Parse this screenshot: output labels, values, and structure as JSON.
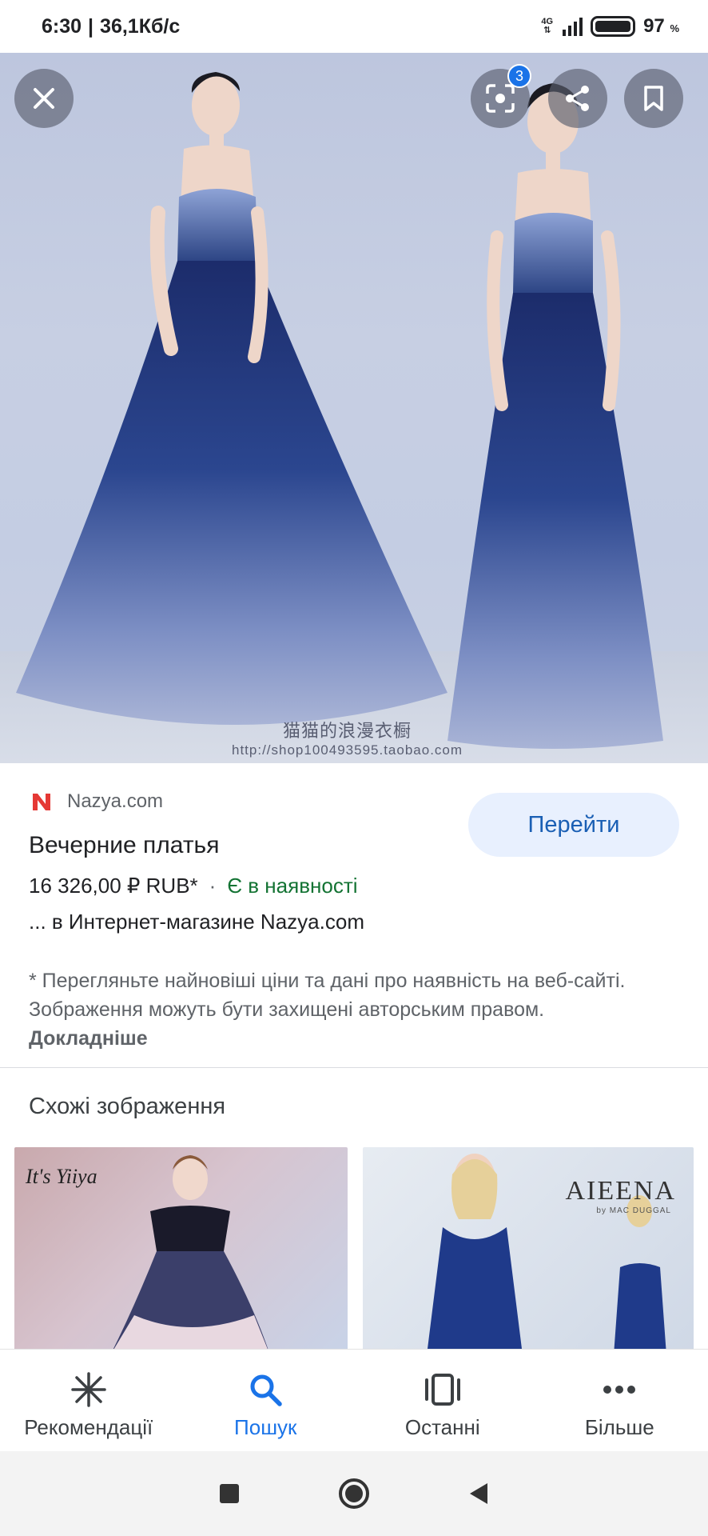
{
  "status_bar": {
    "time": "6:30",
    "separator": "|",
    "speed": "36,1Кб/с",
    "network": "4G",
    "battery_percent": "97",
    "battery_unit": "%"
  },
  "hero": {
    "watermark_cn": "猫猫的浪漫衣橱",
    "watermark_url": "http://shop100493595.taobao.com",
    "lens_badge_count": "3"
  },
  "result": {
    "source_name": "Nazya.com",
    "go_button_label": "Перейти",
    "title": "Вечерние платья",
    "price": "16 326,00 ₽ RUB*",
    "price_separator": "·",
    "availability": "Є в наявності",
    "snippet": "... в Интернет-магазине Nazya.com",
    "disclaimer_text": "* Перегляньте найновіші ціни та дані про наявність на веб-сайті. Зображення можуть бути захищені авторським правом.",
    "disclaimer_link": "Докладніше"
  },
  "similar": {
    "title": "Схожі зображення",
    "items": [
      {
        "caption": "It's Yiiya"
      },
      {
        "caption": "AIEENA",
        "subcaption": "by MAC DUGGAL"
      }
    ]
  },
  "bottom_nav": {
    "items": [
      {
        "label": "Рекомендації",
        "icon": "asterisk-icon"
      },
      {
        "label": "Пошук",
        "icon": "search-icon"
      },
      {
        "label": "Останні",
        "icon": "recent-tabs-icon"
      },
      {
        "label": "Більше",
        "icon": "more-dots-icon"
      }
    ],
    "active_index": 1
  },
  "colors": {
    "accent": "#1a73e8",
    "stock_green": "#137333",
    "go_button_bg": "#e8f0fe",
    "source_logo_red": "#e53935"
  }
}
